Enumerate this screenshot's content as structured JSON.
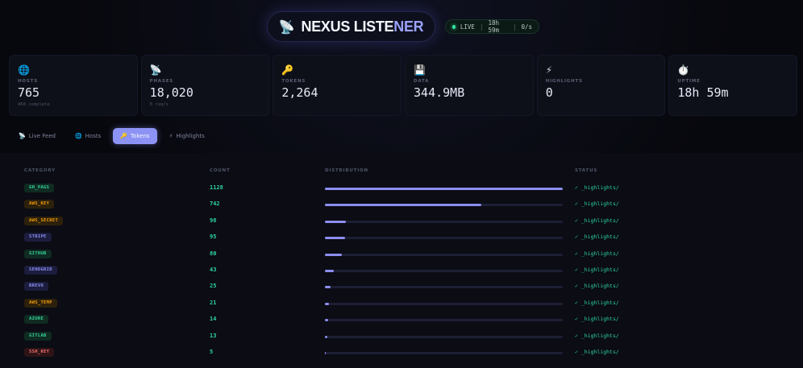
{
  "header": {
    "brand_icon": "📡",
    "brand_part1": "NEXUS LISTE",
    "brand_part2": "NER",
    "live_label": "LIVE",
    "uptime": "18h 59m",
    "rate": "0/s",
    "live_color": "#2ee59d"
  },
  "stats": [
    {
      "icon": "🌐",
      "icon_name": "globe-icon",
      "label": "HOSTS",
      "value": "765",
      "sub": "468 complete"
    },
    {
      "icon": "📡",
      "icon_name": "satellite-icon",
      "label": "PHASES",
      "value": "18,020",
      "sub": "0 req/s"
    },
    {
      "icon": "🔑",
      "icon_name": "key-icon",
      "label": "TOKENS",
      "value": "2,264",
      "sub": ""
    },
    {
      "icon": "💾",
      "icon_name": "floppy-disk-icon",
      "label": "DATA",
      "value": "344.9MB",
      "sub": ""
    },
    {
      "icon": "⚡",
      "icon_name": "lightning-icon",
      "label": "HIGHLIGHTS",
      "value": "0",
      "sub": ""
    },
    {
      "icon": "⏱️",
      "icon_name": "stopwatch-icon",
      "label": "UPTIME",
      "value": "18h 59m",
      "sub": ""
    }
  ],
  "tabs": [
    {
      "icon": "📡",
      "label": "Live Feed",
      "active": false
    },
    {
      "icon": "🌐",
      "label": "Hosts",
      "active": false
    },
    {
      "icon": "🔑",
      "label": "Tokens",
      "active": true
    },
    {
      "icon": "⚡",
      "label": "Highlights",
      "active": false
    }
  ],
  "table": {
    "columns": {
      "category": "CATEGORY",
      "count": "COUNT",
      "distribution": "DISTRIBUTION",
      "status": "STATUS"
    },
    "max_count": 1128,
    "rows": [
      {
        "category": "GH_PAGS",
        "count": 1128,
        "status": "✓ _highlights/",
        "fg": "#34d399",
        "bg": "#0f2b22"
      },
      {
        "category": "AWS_KEY",
        "count": 742,
        "status": "✓ _highlights/",
        "fg": "#f59e0b",
        "bg": "#2d210c"
      },
      {
        "category": "AWS_SECRET",
        "count": 98,
        "status": "✓ _highlights/",
        "fg": "#f59e0b",
        "bg": "#2d210c"
      },
      {
        "category": "STRIPE",
        "count": 95,
        "status": "✓ _highlights/",
        "fg": "#8b8ff5",
        "bg": "#1c1d3d"
      },
      {
        "category": "GITHUB",
        "count": 80,
        "status": "✓ _highlights/",
        "fg": "#34d399",
        "bg": "#0f2b22"
      },
      {
        "category": "SENDGRID",
        "count": 43,
        "status": "✓ _highlights/",
        "fg": "#8b8ff5",
        "bg": "#1c1d3d"
      },
      {
        "category": "BREVO",
        "count": 25,
        "status": "✓ _highlights/",
        "fg": "#8b8ff5",
        "bg": "#1c1d3d"
      },
      {
        "category": "AWS_TEMP",
        "count": 21,
        "status": "✓ _highlights/",
        "fg": "#f59e0b",
        "bg": "#2d210c"
      },
      {
        "category": "AZURE",
        "count": 14,
        "status": "✓ _highlights/",
        "fg": "#34d399",
        "bg": "#0f2b22"
      },
      {
        "category": "GITLAB",
        "count": 13,
        "status": "✓ _highlights/",
        "fg": "#34d399",
        "bg": "#0f2b22"
      },
      {
        "category": "SSH_KEY",
        "count": 5,
        "status": "✓ _highlights/",
        "fg": "#f87171",
        "bg": "#2e1416"
      }
    ]
  }
}
